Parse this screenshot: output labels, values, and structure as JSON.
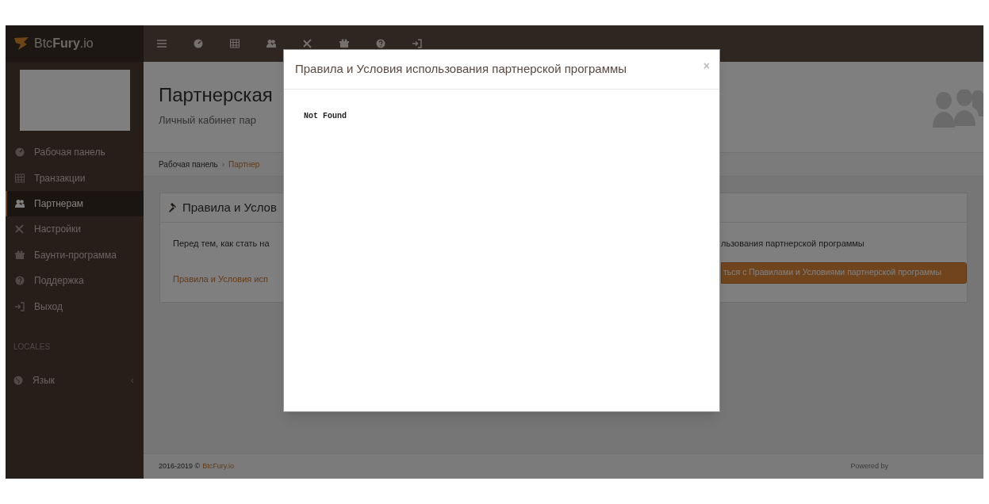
{
  "brand": {
    "name": "Btc**Fury**.io"
  },
  "sidebar": {
    "items": [
      {
        "label": "Рабочая панель",
        "selected": false
      },
      {
        "label": "Транзакции",
        "selected": false
      },
      {
        "label": "Партнерам",
        "selected": true
      },
      {
        "label": "Настройки",
        "selected": false
      },
      {
        "label": "Баунти-программа",
        "selected": false
      },
      {
        "label": "Поддержка",
        "selected": false
      },
      {
        "label": "Выход",
        "selected": false
      }
    ],
    "section_label": "LOCALES",
    "language_item": {
      "label": "Язык",
      "expand_glyph": "‹"
    }
  },
  "page_header": {
    "title": "Партнерская",
    "subtitle": "Личный кабинет пар"
  },
  "breadcrumb": {
    "separator": "›",
    "items": [
      {
        "label": "Рабочая панель",
        "current": false
      },
      {
        "label": "Партнер",
        "current": true
      }
    ]
  },
  "panel": {
    "title": "Правила и Услов",
    "text_left": "Перед тем, как стать на",
    "text_right": "льзования партнерской программы",
    "link": "Правила и Условия исп",
    "button": "ться с Правилами и Условиями партнерской программы"
  },
  "footer": {
    "copyright": "2016-2019 ©",
    "link": "BtcFury.io",
    "powered": "Powered by"
  },
  "modal": {
    "title": "Правила и Условия использования партнерской программы",
    "close": "×",
    "body": "Not Found"
  }
}
